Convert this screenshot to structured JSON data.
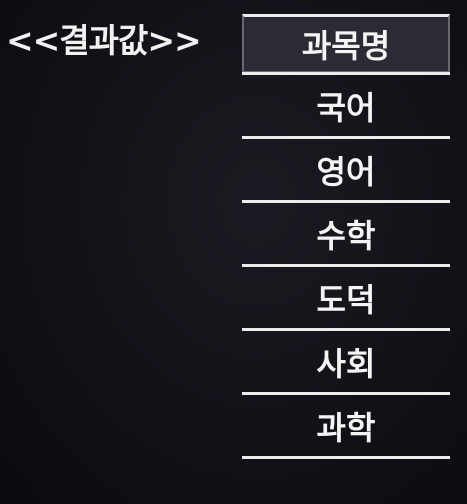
{
  "title": "<<결과값>>",
  "table": {
    "header": "과목명",
    "rows": [
      "국어",
      "영어",
      "수학",
      "도덕",
      "사회",
      "과학"
    ]
  },
  "colors": {
    "background": "#131118",
    "text": "#f4f4f4",
    "header_fill": "#2d2a35",
    "rule": "#ececec"
  }
}
